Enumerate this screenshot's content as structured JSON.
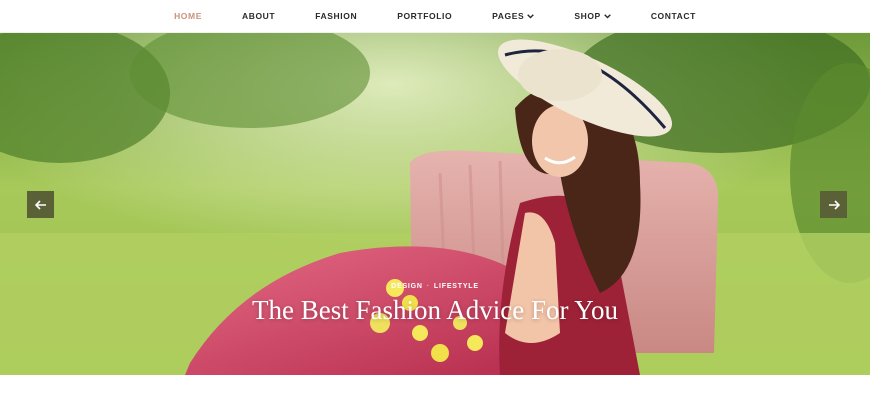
{
  "nav": {
    "items": [
      {
        "label": "HOME",
        "active": true,
        "dropdown": false
      },
      {
        "label": "ABOUT",
        "active": false,
        "dropdown": false
      },
      {
        "label": "FASHION",
        "active": false,
        "dropdown": false
      },
      {
        "label": "PORTFOLIO",
        "active": false,
        "dropdown": false
      },
      {
        "label": "PAGES",
        "active": false,
        "dropdown": true
      },
      {
        "label": "SHOP",
        "active": false,
        "dropdown": true
      },
      {
        "label": "CONTACT",
        "active": false,
        "dropdown": false
      }
    ]
  },
  "hero": {
    "categories": [
      "DESIGN",
      "LIFESTYLE"
    ],
    "title": "The Best Fashion Advice For You",
    "prev_icon": "arrow-left-icon",
    "next_icon": "arrow-right-icon"
  },
  "colors": {
    "accent": "#c8927c",
    "nav_text": "#2a2a2a",
    "arrow_bg": "#5a6136"
  }
}
